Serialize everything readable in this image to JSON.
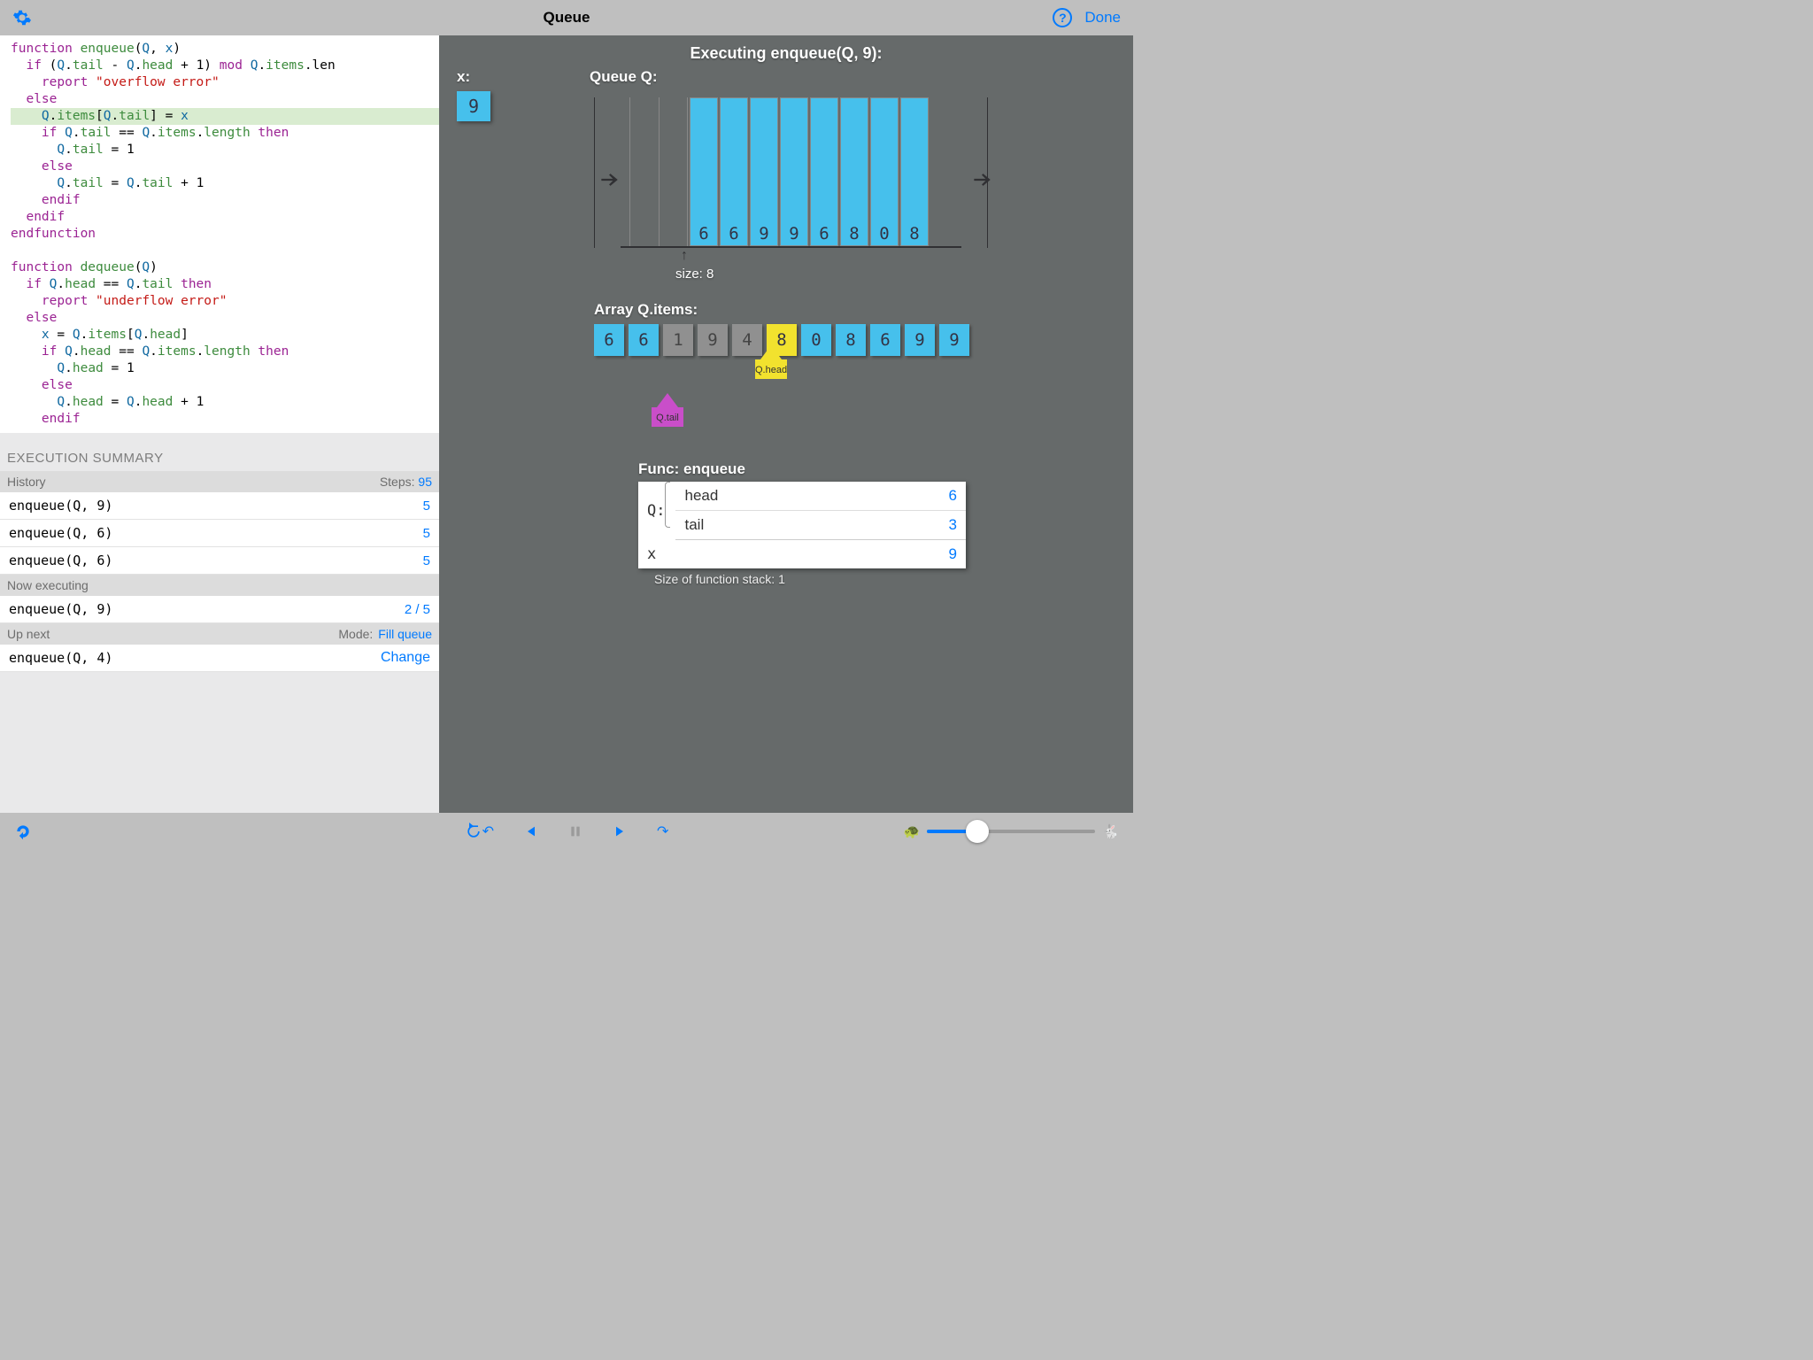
{
  "title": "Queue",
  "done": "Done",
  "exec_title": "Executing enqueue(Q, 9):",
  "x_label": "x:",
  "x_value": "9",
  "q_label": "Queue Q:",
  "queue_size_label": "size: 8",
  "array_label": "Array Q.items:",
  "qhead_label": "Q.head",
  "qtail_label": "Q.tail",
  "func_label": "Func: enqueue",
  "func_rows": {
    "q": "Q:",
    "head_k": "head",
    "head_v": "6",
    "tail_k": "tail",
    "tail_v": "3",
    "x_k": "x",
    "x_v": "9"
  },
  "stack_size": "Size of function stack: 1",
  "exec_summary": "EXECUTION SUMMARY",
  "history_label": "History",
  "steps_label": "Steps:",
  "steps_total": "95",
  "history": [
    {
      "call": "enqueue(Q, 9)",
      "n": "5"
    },
    {
      "call": "enqueue(Q, 6)",
      "n": "5"
    },
    {
      "call": "enqueue(Q, 6)",
      "n": "5"
    }
  ],
  "now_label": "Now executing",
  "now": {
    "call": "enqueue(Q, 9)",
    "n": "2 / 5"
  },
  "upnext_label": "Up next",
  "mode_label": "Mode:",
  "mode_value": "Fill queue",
  "upnext": {
    "call": "enqueue(Q, 4)",
    "action": "Change"
  },
  "queue_cols": [
    "6",
    "6",
    "9",
    "9",
    "6",
    "8",
    "0",
    "8"
  ],
  "array_cells": [
    {
      "v": "6",
      "c": "c-blue"
    },
    {
      "v": "6",
      "c": "c-blue"
    },
    {
      "v": "1",
      "c": "c-gray"
    },
    {
      "v": "9",
      "c": "c-gray"
    },
    {
      "v": "4",
      "c": "c-gray"
    },
    {
      "v": "8",
      "c": "c-yellow"
    },
    {
      "v": "0",
      "c": "c-blue"
    },
    {
      "v": "8",
      "c": "c-blue"
    },
    {
      "v": "6",
      "c": "c-blue"
    },
    {
      "v": "9",
      "c": "c-blue"
    },
    {
      "v": "9",
      "c": "c-blue"
    }
  ],
  "code": {
    "l1a": "function",
    "l1b": " enqueue",
    "l1c": "(",
    "l1d": "Q",
    "l1e": ", ",
    "l1f": "x",
    "l1g": ")",
    "l2a": "  if",
    "l2b": " (",
    "l2c": "Q",
    "l2d": ".",
    "l2e": "tail",
    "l2f": " - ",
    "l2g": "Q",
    "l2h": ".",
    "l2i": "head",
    "l2j": " + 1) ",
    "l2k": "mod",
    "l2l": " ",
    "l2m": "Q",
    "l2n": ".",
    "l2o": "items",
    "l2p": ".len",
    "l3a": "    report",
    "l3b": " \"overflow error\"",
    "l4a": "  else",
    "l5a": "    ",
    "l5b": "Q",
    "l5c": ".",
    "l5d": "items",
    "l5e": "[",
    "l5f": "Q",
    "l5g": ".",
    "l5h": "tail",
    "l5i": "] = ",
    "l5j": "x",
    "l6a": "    if",
    "l6b": " ",
    "l6c": "Q",
    "l6d": ".",
    "l6e": "tail",
    "l6f": " == ",
    "l6g": "Q",
    "l6h": ".",
    "l6i": "items",
    "l6j": ".",
    "l6k": "length",
    "l6l": " then",
    "l7a": "      ",
    "l7b": "Q",
    "l7c": ".",
    "l7d": "tail",
    "l7e": " = 1",
    "l8a": "    else",
    "l9a": "      ",
    "l9b": "Q",
    "l9c": ".",
    "l9d": "tail",
    "l9e": " = ",
    "l9f": "Q",
    "l9g": ".",
    "l9h": "tail",
    "l9i": " + 1",
    "l10a": "    endif",
    "l11a": "  endif",
    "l12a": "endfunction",
    "l14a": "function",
    "l14b": " dequeue",
    "l14c": "(",
    "l14d": "Q",
    "l14e": ")",
    "l15a": "  if",
    "l15b": " ",
    "l15c": "Q",
    "l15d": ".",
    "l15e": "head",
    "l15f": " == ",
    "l15g": "Q",
    "l15h": ".",
    "l15i": "tail",
    "l15j": " then",
    "l16a": "    report",
    "l16b": " \"underflow error\"",
    "l17a": "  else",
    "l18a": "    ",
    "l18b": "x",
    "l18c": " = ",
    "l18d": "Q",
    "l18e": ".",
    "l18f": "items",
    "l18g": "[",
    "l18h": "Q",
    "l18i": ".",
    "l18j": "head",
    "l18k": "]",
    "l19a": "    if",
    "l19b": " ",
    "l19c": "Q",
    "l19d": ".",
    "l19e": "head",
    "l19f": " == ",
    "l19g": "Q",
    "l19h": ".",
    "l19i": "items",
    "l19j": ".",
    "l19k": "length",
    "l19l": " then",
    "l20a": "      ",
    "l20b": "Q",
    "l20c": ".",
    "l20d": "head",
    "l20e": " = 1",
    "l21a": "    else",
    "l22a": "      ",
    "l22b": "Q",
    "l22c": ".",
    "l22d": "head",
    "l22e": " = ",
    "l22f": "Q",
    "l22g": ".",
    "l22h": "head",
    "l22i": " + 1",
    "l23a": "    endif"
  }
}
